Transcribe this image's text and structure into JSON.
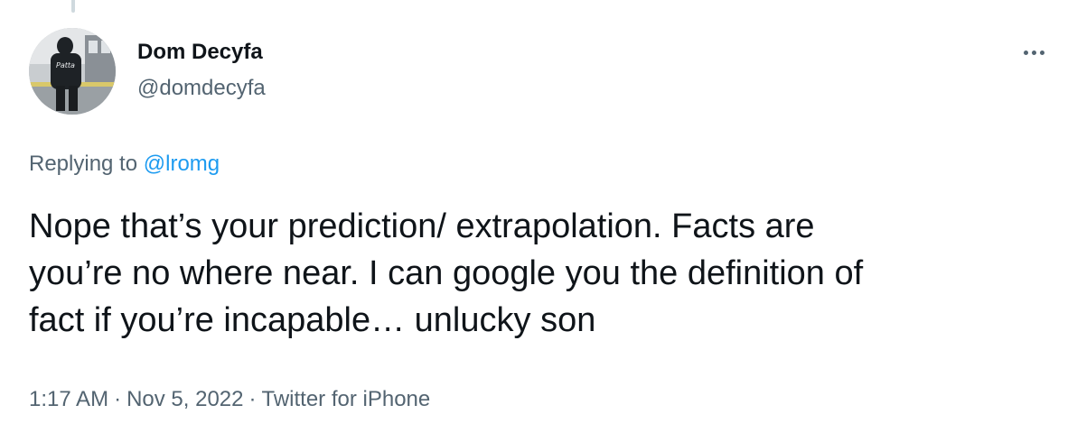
{
  "tweet": {
    "author": {
      "display_name": "Dom Decyfa",
      "handle": "@domdecyfa",
      "avatar_icon": "user-avatar-photo"
    },
    "more_icon": "more-horizontal-icon",
    "reply": {
      "prefix": "Replying to ",
      "mention": "@lromg"
    },
    "text": "Nope that’s your prediction/ extrapolation. Facts are\nyou’re no where near. I can google you the definition of\nfact if you’re incapable… unlucky son",
    "meta": {
      "time": "1:17 AM",
      "separator": "·",
      "date": "Nov 5, 2022",
      "source": "Twitter for iPhone"
    },
    "colors": {
      "text": "#0f1419",
      "secondary": "#536471",
      "link": "#1d9bf0",
      "thread_line": "#cfd9de"
    }
  }
}
